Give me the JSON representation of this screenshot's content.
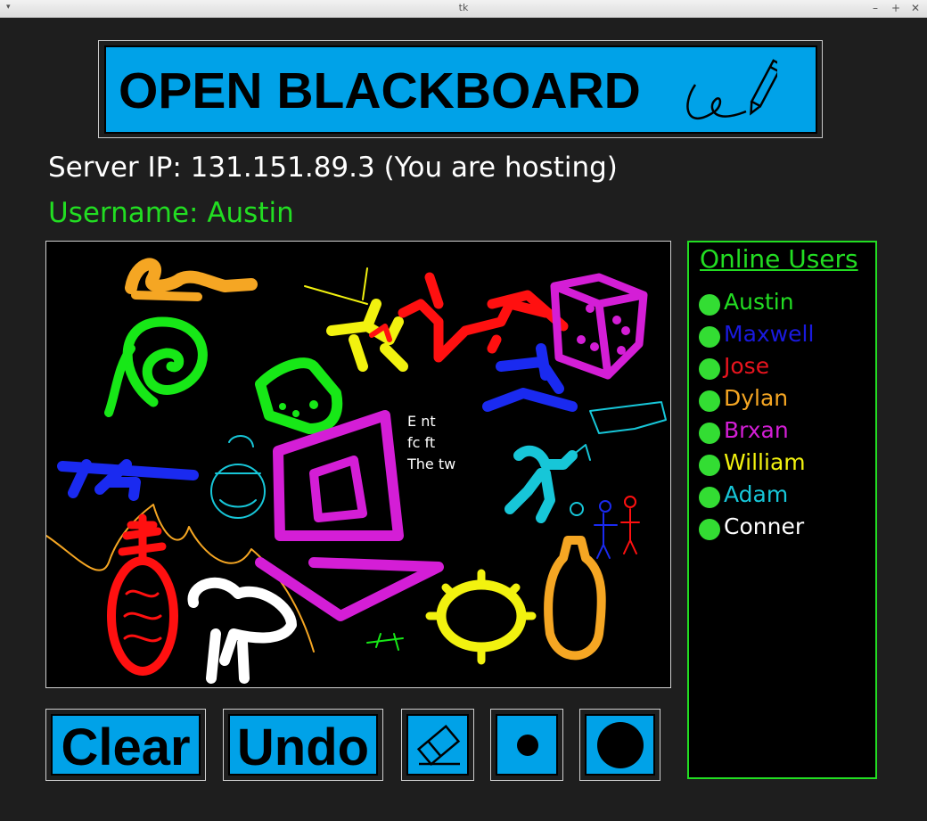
{
  "window": {
    "title": "tk",
    "menu_glyph": "▾",
    "min_glyph": "–",
    "max_glyph": "+",
    "close_glyph": "✕"
  },
  "banner": {
    "title": "OPEN BLACKBOARD",
    "icon": "pen-scribble-icon",
    "background": "#00a2e8"
  },
  "server_ip_text": "Server IP: 131.151.89.3 (You are hosting)",
  "username_text": "Username: Austin",
  "canvas": {
    "background": "#000000",
    "handwritten_text": [
      "E nt",
      "fc ft",
      "The tw"
    ]
  },
  "online_users": {
    "title": "Online Users",
    "status_color": "#33dd33",
    "users": [
      {
        "name": "Austin",
        "color": "#22dd22"
      },
      {
        "name": "Maxwell",
        "color": "#1a1adf"
      },
      {
        "name": "Jose",
        "color": "#e8141e"
      },
      {
        "name": "Dylan",
        "color": "#f5a623"
      },
      {
        "name": "Brxan",
        "color": "#d41ed6"
      },
      {
        "name": "William",
        "color": "#f2f20f"
      },
      {
        "name": "Adam",
        "color": "#17c6d8"
      },
      {
        "name": "Conner",
        "color": "#ffffff"
      }
    ]
  },
  "toolbar": {
    "clear_label": "Clear",
    "undo_label": "Undo",
    "eraser_icon": "eraser-icon",
    "small_brush_icon": "small-brush-icon",
    "large_brush_icon": "large-brush-icon"
  }
}
